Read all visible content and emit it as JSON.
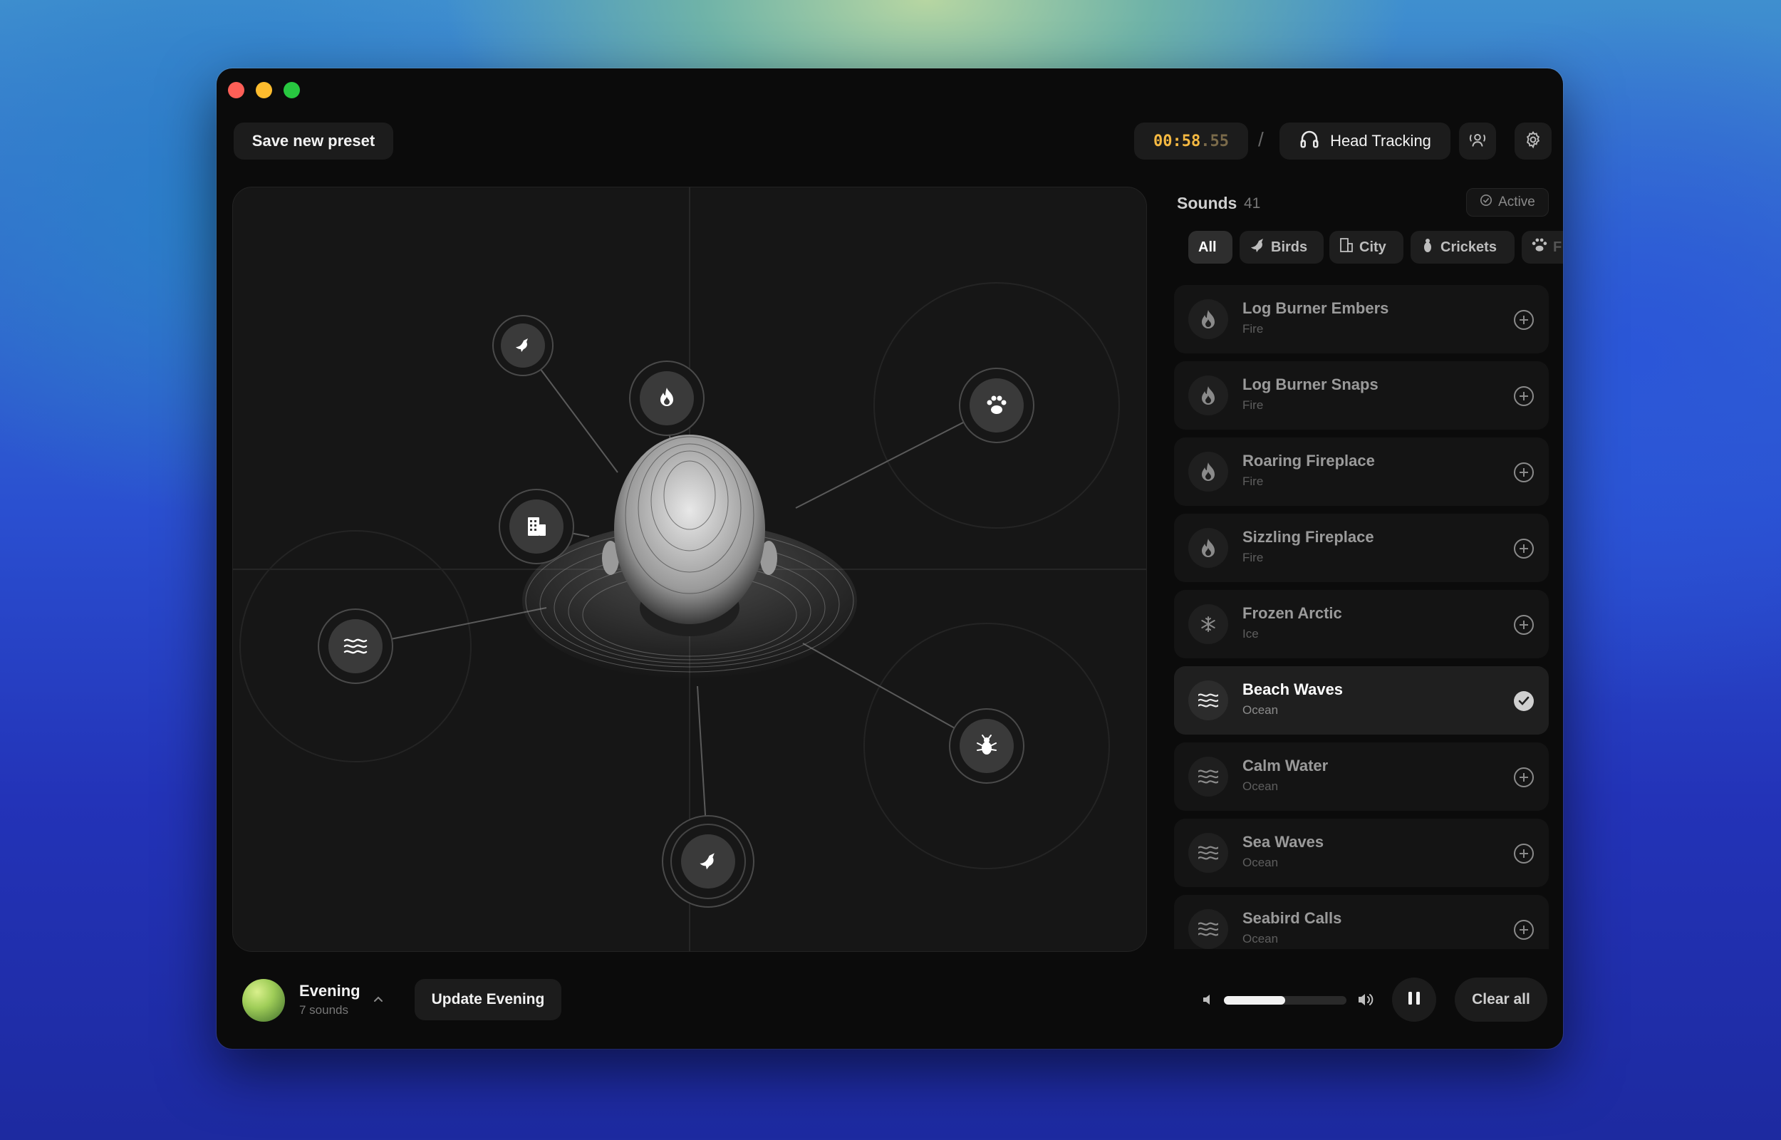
{
  "toolbar": {
    "save_preset_label": "Save new preset",
    "timer_main": "00:58",
    "timer_fraction": ".55",
    "separator": "/",
    "head_tracking_label": "Head Tracking"
  },
  "sounds_panel": {
    "title": "Sounds",
    "count": "41",
    "active_label": "Active",
    "filters": [
      {
        "label": "All",
        "icon": "none"
      },
      {
        "label": "Birds",
        "icon": "bird-icon"
      },
      {
        "label": "City",
        "icon": "building-icon"
      },
      {
        "label": "Crickets",
        "icon": "bug-icon"
      },
      {
        "label": "F",
        "icon": "paw-icon"
      }
    ],
    "items": [
      {
        "name": "Log Burner Embers",
        "category": "Fire",
        "icon": "flame-icon",
        "added": false
      },
      {
        "name": "Log Burner Snaps",
        "category": "Fire",
        "icon": "flame-icon",
        "added": false
      },
      {
        "name": "Roaring Fireplace",
        "category": "Fire",
        "icon": "flame-icon",
        "added": false
      },
      {
        "name": "Sizzling Fireplace",
        "category": "Fire",
        "icon": "flame-icon",
        "added": false
      },
      {
        "name": "Frozen Arctic",
        "category": "Ice",
        "icon": "snowflake-icon",
        "added": false
      },
      {
        "name": "Beach Waves",
        "category": "Ocean",
        "icon": "waves-icon",
        "added": true
      },
      {
        "name": "Calm Water",
        "category": "Ocean",
        "icon": "waves-icon",
        "added": false
      },
      {
        "name": "Sea Waves",
        "category": "Ocean",
        "icon": "waves-icon",
        "added": false
      },
      {
        "name": "Seabird Calls",
        "category": "Ocean",
        "icon": "waves-icon",
        "added": false
      }
    ]
  },
  "soundstage": {
    "sources": [
      {
        "icon": "bird-icon",
        "name": "source-bird-top"
      },
      {
        "icon": "flame-icon",
        "name": "source-fire"
      },
      {
        "icon": "paw-icon",
        "name": "source-animal"
      },
      {
        "icon": "building-icon",
        "name": "source-city"
      },
      {
        "icon": "waves-icon",
        "name": "source-waves"
      },
      {
        "icon": "bug-icon",
        "name": "source-crickets"
      },
      {
        "icon": "bird-icon",
        "name": "source-bird-bottom"
      }
    ]
  },
  "footer": {
    "preset_name": "Evening",
    "preset_sub": "7 sounds",
    "update_label": "Update Evening",
    "volume_level": 0.5,
    "clear_label": "Clear all"
  },
  "colors": {
    "timer_accent": "#f5b942",
    "window_bg": "#0b0b0b"
  }
}
